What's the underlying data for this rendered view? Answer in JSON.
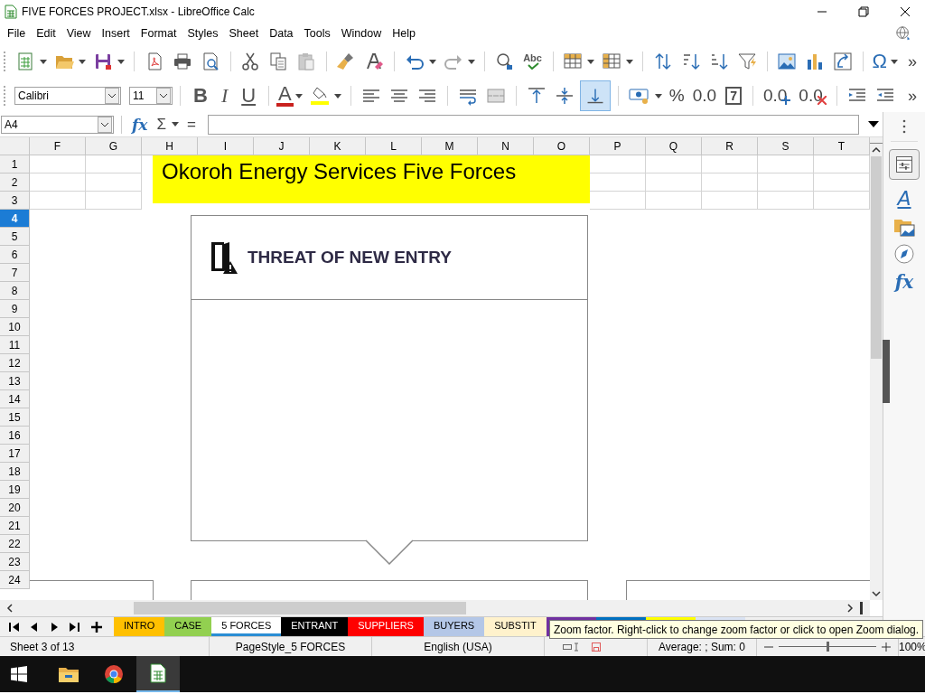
{
  "window": {
    "title": "FIVE FORCES PROJECT.xlsx - LibreOffice Calc"
  },
  "menu": [
    "File",
    "Edit",
    "View",
    "Insert",
    "Format",
    "Styles",
    "Sheet",
    "Data",
    "Tools",
    "Window",
    "Help"
  ],
  "standard_toolbar": {
    "spelling": "Abc",
    "special_character": "Ω",
    "overflow": "»"
  },
  "format_toolbar": {
    "font_name": "Calibri",
    "font_size": "11",
    "bold": "B",
    "italic": "I",
    "underline": "U",
    "font_color": "A",
    "percent": "%",
    "decimal_format": "0.0",
    "general_format": "7",
    "add_decimal": "0.0",
    "delete_decimal": "0.0",
    "overflow": "»",
    "align_bottom": {
      "selected": true
    }
  },
  "formula_bar": {
    "name_box": "A4",
    "function_wizard": "fx",
    "sum": "Σ",
    "equals": "="
  },
  "columns": [
    "F",
    "G",
    "H",
    "I",
    "J",
    "K",
    "L",
    "M",
    "N",
    "O",
    "P",
    "Q",
    "R",
    "S",
    "T"
  ],
  "rows": [
    {
      "label": "1",
      "selected": false
    },
    {
      "label": "2",
      "selected": false
    },
    {
      "label": "3",
      "selected": false
    },
    {
      "label": "4",
      "selected": true
    },
    {
      "label": "5",
      "selected": false
    },
    {
      "label": "6",
      "selected": false
    },
    {
      "label": "7",
      "selected": false
    },
    {
      "label": "8",
      "selected": false
    },
    {
      "label": "9",
      "selected": false
    },
    {
      "label": "10",
      "selected": false
    },
    {
      "label": "11",
      "selected": false
    },
    {
      "label": "12",
      "selected": false
    },
    {
      "label": "13",
      "selected": false
    },
    {
      "label": "14",
      "selected": false
    },
    {
      "label": "15",
      "selected": false
    },
    {
      "label": "16",
      "selected": false
    },
    {
      "label": "17",
      "selected": false
    },
    {
      "label": "18",
      "selected": false
    },
    {
      "label": "19",
      "selected": false
    },
    {
      "label": "20",
      "selected": false
    },
    {
      "label": "21",
      "selected": false
    },
    {
      "label": "22",
      "selected": false
    },
    {
      "label": "23",
      "selected": false
    },
    {
      "label": "24",
      "selected": false
    }
  ],
  "sheet": {
    "title": "Okoroh Energy Services Five Forces",
    "box_heading": "THREAT OF NEW ENTRY"
  },
  "sheet_tabs": [
    {
      "label": "INTRO",
      "color": "#ffc000",
      "selected": false
    },
    {
      "label": "CASE",
      "color": "#92d050",
      "selected": false
    },
    {
      "label": "5 FORCES",
      "color": "#2a8dd4",
      "selected": true
    },
    {
      "label": "ENTRANT",
      "color": "#000000",
      "selected": false
    },
    {
      "label": "SUPPLIERS",
      "color": "#ff0000",
      "selected": false
    },
    {
      "label": "BUYERS",
      "color": "#b4c7e7",
      "selected": false
    },
    {
      "label": "SUBSTIT",
      "color": "#fff2cc",
      "selected": false
    },
    {
      "color": "#7030a0",
      "selected": false
    },
    {
      "color": "#0070c0",
      "selected": false
    },
    {
      "color": "#ffff00",
      "selected": false
    },
    {
      "color": "#dae3f3",
      "selected": false
    }
  ],
  "sidebar": [
    {
      "kind": "properties",
      "selected": true
    },
    {
      "kind": "styles",
      "glyph": "A",
      "selected": false
    },
    {
      "kind": "gallery",
      "selected": false
    },
    {
      "kind": "navigator",
      "selected": false
    },
    {
      "kind": "functions",
      "glyph": "fx",
      "selected": false
    }
  ],
  "tooltip": "Zoom factor. Right-click to change zoom factor or click to open Zoom dialog.",
  "status_bar": {
    "sheet": "Sheet 3 of 13",
    "page_style": "PageStyle_5 FORCES",
    "language": "English (USA)",
    "selection_summary": "Average: ; Sum: 0",
    "zoom": {
      "level": 0.5
    },
    "zoom_reading": "100%"
  }
}
